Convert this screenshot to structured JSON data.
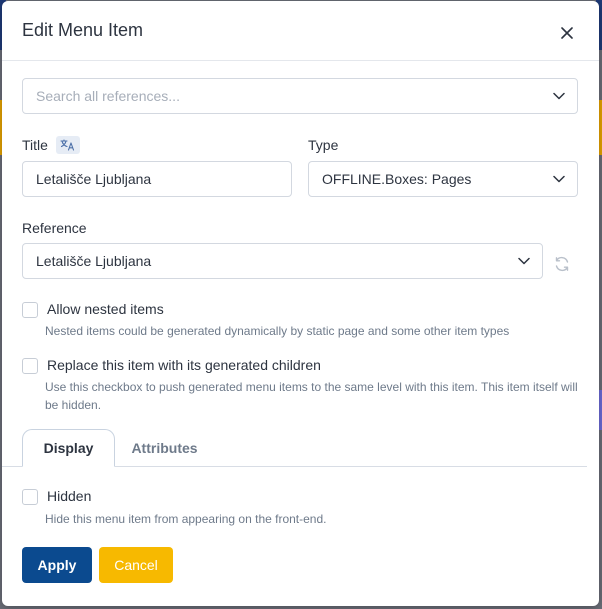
{
  "dialog": {
    "title": "Edit Menu Item",
    "close_icon": "close-icon"
  },
  "search": {
    "placeholder": "Search all references..."
  },
  "title_field": {
    "label": "Title",
    "value": "Letališče Ljubljana",
    "badge_icon": "translate-icon"
  },
  "type_field": {
    "label": "Type",
    "value": "OFFLINE.Boxes: Pages"
  },
  "reference_field": {
    "label": "Reference",
    "value": "Letališče Ljubljana",
    "refresh_icon": "refresh-icon"
  },
  "options": {
    "nested": {
      "label": "Allow nested items",
      "help": "Nested items could be generated dynamically by static page and some other item types"
    },
    "replace": {
      "label": "Replace this item with its generated children",
      "help": "Use this checkbox to push generated menu items to the same level with this item. This item itself will be hidden."
    },
    "hidden": {
      "label": "Hidden",
      "help": "Hide this menu item from appearing on the front-end."
    }
  },
  "tabs": {
    "display": "Display",
    "attributes": "Attributes"
  },
  "buttons": {
    "apply": "Apply",
    "cancel": "Cancel"
  },
  "colors": {
    "primary": "#0b4a8f",
    "warning": "#f7b900"
  }
}
